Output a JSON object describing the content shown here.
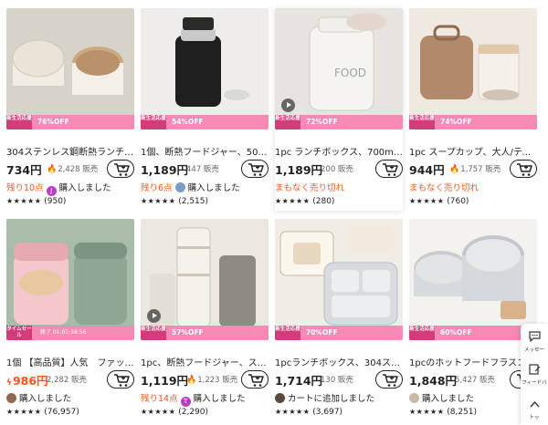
{
  "products": [
    {
      "title": "304ステンレス鋼断熱ランチ…",
      "price": "734円",
      "sold": "2,428 販売",
      "sold_hot": true,
      "price_red": false,
      "banner_tag": "新生活応援",
      "discount": "76%OFF",
      "status_prefix": "残り10点",
      "status_text": "購入しました",
      "status_style": "red-prefix",
      "avatar": "J",
      "avatar_color": "#b83fbf",
      "stars": "★★★★★",
      "reviews": "(950)",
      "video": false,
      "highlight": false
    },
    {
      "title": "1個、断熱フードジャー、50…",
      "price": "1,189円",
      "sold": "447 販売",
      "sold_hot": false,
      "price_red": false,
      "banner_tag": "新生活応援",
      "discount": "54%OFF",
      "status_prefix": "残り6点",
      "status_text": "購入しました",
      "status_style": "red-prefix",
      "avatar": "",
      "avatar_color": "#7e9bc4",
      "stars": "★★★★★",
      "reviews": "(2,515)",
      "video": false,
      "highlight": false
    },
    {
      "title": "1pc ランチボックス、700ml/…",
      "price": "1,189円",
      "sold": "200 販売",
      "sold_hot": false,
      "price_red": false,
      "banner_tag": "新生活応援",
      "discount": "72%OFF",
      "status_prefix": "",
      "status_text": "まもなく売り切れ",
      "status_style": "red",
      "avatar": "",
      "avatar_color": "",
      "stars": "★★★★★",
      "reviews": "(280)",
      "video": true,
      "highlight": true
    },
    {
      "title": "1pc スープカップ、大人/ティ…",
      "price": "944円",
      "sold": "1,757 販売",
      "sold_hot": true,
      "price_red": false,
      "banner_tag": "新生活応援",
      "discount": "74%OFF",
      "status_prefix": "",
      "status_text": "まもなく売り切れ",
      "status_style": "red",
      "avatar": "",
      "avatar_color": "",
      "stars": "★★★★★",
      "reviews": "(760)",
      "video": false,
      "highlight": false
    },
    {
      "title": "1個 【高品質】人気　ファッ…",
      "price": "986円",
      "sold": "2,282 販売",
      "sold_hot": false,
      "price_red": true,
      "banner_tag": "タイムセール",
      "discount": "終了 01:01:58:56",
      "status_prefix": "",
      "status_text": "購入しました",
      "status_style": "normal",
      "avatar": "",
      "avatar_color": "#8a6a55",
      "stars": "★★★★★",
      "reviews": "(76,957)",
      "video": false,
      "highlight": false
    },
    {
      "title": "1pc、断熱フードジャー、ス…",
      "price": "1,119円",
      "sold": "1,223 販売",
      "sold_hot": true,
      "price_red": false,
      "banner_tag": "新生活応援",
      "discount": "57%OFF",
      "status_prefix": "残り14点",
      "status_text": "購入しました",
      "status_style": "red-prefix",
      "avatar": "T",
      "avatar_color": "#b83fbf",
      "stars": "★★★★★",
      "reviews": "(2,290)",
      "video": true,
      "highlight": false
    },
    {
      "title": "1pcランチボックス、304ス…",
      "price": "1,714円",
      "sold": "130 販売",
      "sold_hot": false,
      "price_red": false,
      "banner_tag": "新生活応援",
      "discount": "70%OFF",
      "status_prefix": "",
      "status_text": "カートに追加しました",
      "status_style": "normal",
      "avatar": "",
      "avatar_color": "#5a4a3e",
      "stars": "★★★★★",
      "reviews": "(3,697)",
      "video": false,
      "highlight": false
    },
    {
      "title": "1pcのホットフードフラスコ…",
      "price": "1,848円",
      "sold": "5,427 販売",
      "sold_hot": false,
      "price_red": false,
      "banner_tag": "新生活応援",
      "discount": "60%OFF",
      "status_prefix": "",
      "status_text": "購入しました",
      "status_style": "normal",
      "avatar": "",
      "avatar_color": "#c9b9a8",
      "stars": "★★★★★",
      "reviews": "(8,251)",
      "video": false,
      "highlight": false
    }
  ],
  "side_panel": {
    "items": [
      {
        "label": "メッセー",
        "icon": "message-icon"
      },
      {
        "label": "フィードバ",
        "icon": "feedback-icon"
      },
      {
        "label": "トッ",
        "icon": "back-to-top-icon"
      }
    ]
  },
  "colors": {
    "accent": "#f2571b",
    "banner": "#f58ab5",
    "banner_tag": "#d23d79"
  }
}
